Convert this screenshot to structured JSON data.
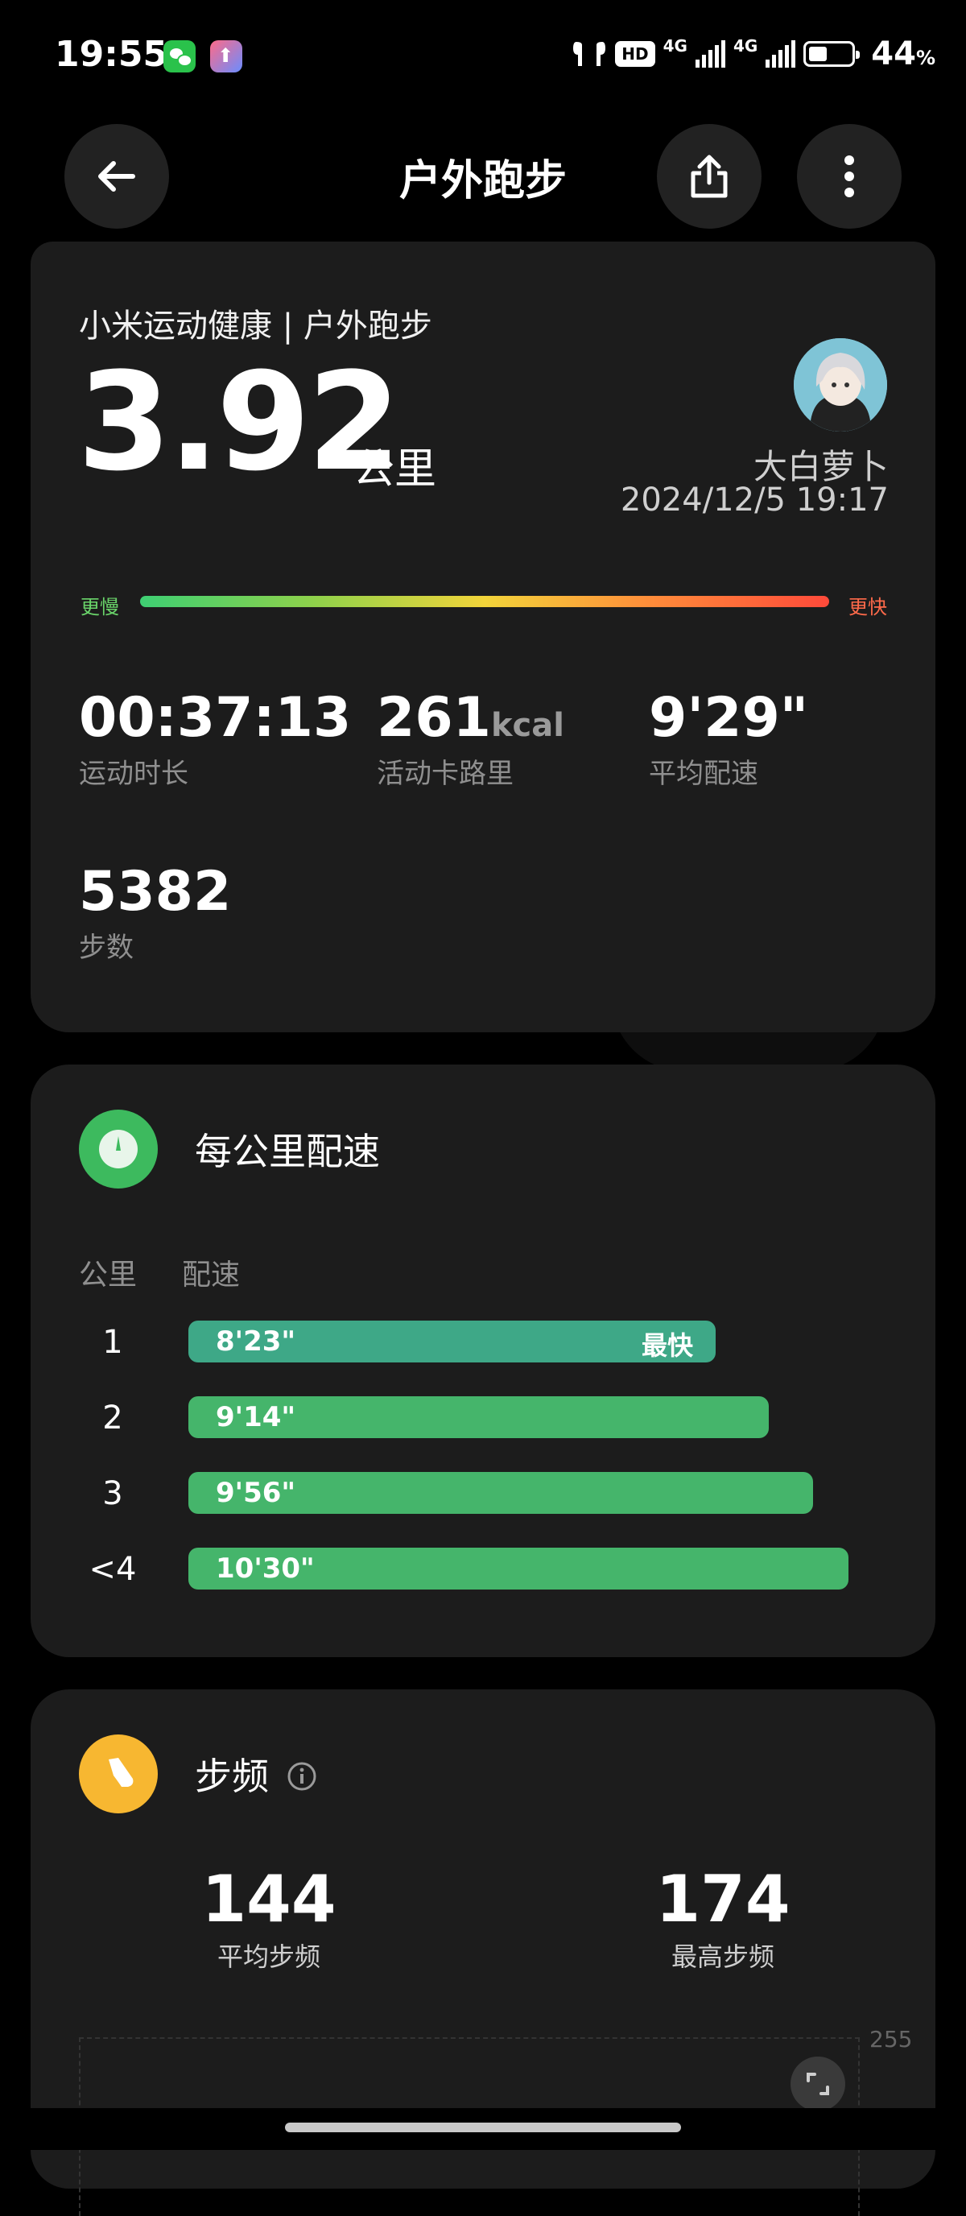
{
  "status_bar": {
    "time": "19:55",
    "hd_badge": "HD",
    "net1": "4G",
    "net2": "4G",
    "battery_level": 0.44,
    "battery_pct": "44",
    "battery_pct_sign": "%"
  },
  "header": {
    "title": "户外跑步",
    "icons": [
      "back-arrow-icon",
      "share-icon",
      "more-vertical-icon"
    ]
  },
  "summary": {
    "subtitle": "小米运动健康 | 户外跑步",
    "distance": "3.92",
    "distance_unit": "公里",
    "user_name": "大白萝卜",
    "datetime": "2024/12/5 19:17",
    "pace_slow_label": "更慢",
    "pace_fast_label": "更快",
    "duration_value": "00:37:13",
    "duration_label": "运动时长",
    "calories_value": "261",
    "calories_unit": "kcal",
    "calories_label": "活动卡路里",
    "avg_pace_value": "9'29\"",
    "avg_pace_label": "平均配速",
    "steps_value": "5382",
    "steps_label": "步数"
  },
  "pace_per_km": {
    "title": "每公里配速",
    "col_km": "公里",
    "col_pace": "配速",
    "best_label": "最快",
    "rows": [
      {
        "km": "1",
        "pace": "8'23\"",
        "seconds": 503,
        "best": true
      },
      {
        "km": "2",
        "pace": "9'14\"",
        "seconds": 554,
        "best": false
      },
      {
        "km": "3",
        "pace": "9'56\"",
        "seconds": 596,
        "best": false
      },
      {
        "km": "<4",
        "pace": "10'30\"",
        "seconds": 630,
        "best": false
      }
    ]
  },
  "cadence": {
    "title": "步频",
    "avg_value": "144",
    "avg_label": "平均步频",
    "max_value": "174",
    "max_label": "最高步频",
    "chart_max_label": "255"
  },
  "colors": {
    "background": "#000000",
    "card": "#1c1c1c",
    "pace_bar": "#45b56b",
    "pace_bar_best": "#3ea887",
    "pace_icon": "#3dba5e",
    "cadence_icon": "#f7b731",
    "slow": "#6ad46a",
    "fast": "#ff6a4a"
  }
}
